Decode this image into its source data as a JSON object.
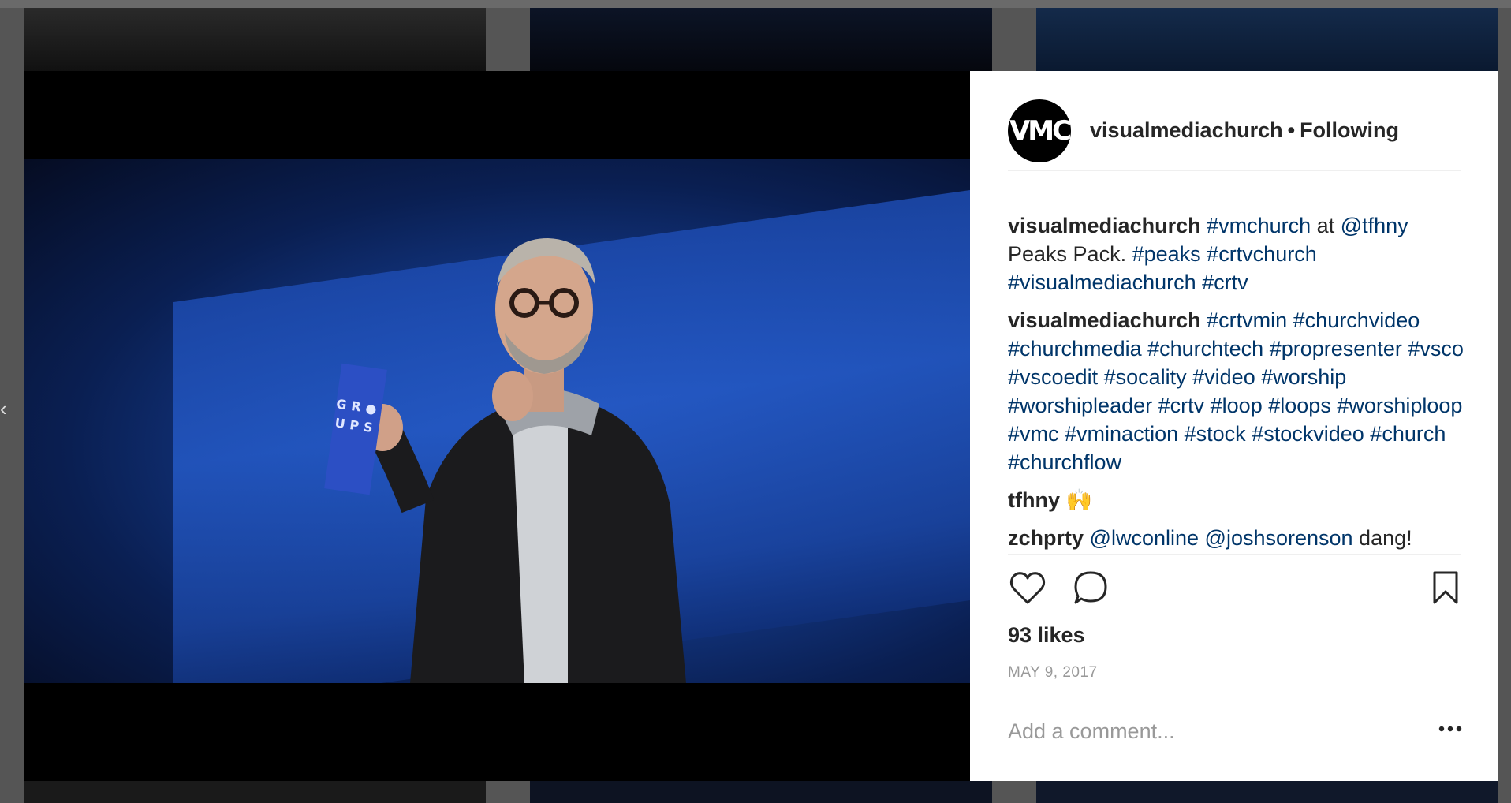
{
  "post": {
    "author": "visualmediachurch",
    "avatar_text": "VMC",
    "follow_separator": "•",
    "follow_status": "Following",
    "image_alt": "Speaker on stage holding a GROUPS card",
    "card_text": "GR●UPS"
  },
  "comments": [
    {
      "user": "visualmediachurch",
      "parts": [
        {
          "t": "tag",
          "v": "#vmchurch"
        },
        {
          "t": "text",
          "v": " at "
        },
        {
          "t": "tag",
          "v": "@tfhny"
        },
        {
          "t": "text",
          "v": " Peaks Pack. "
        },
        {
          "t": "tag",
          "v": "#peaks"
        },
        {
          "t": "text",
          "v": " "
        },
        {
          "t": "tag",
          "v": "#crtvchurch"
        },
        {
          "t": "text",
          "v": " "
        },
        {
          "t": "tag",
          "v": "#visualmediachurch"
        },
        {
          "t": "text",
          "v": " "
        },
        {
          "t": "tag",
          "v": "#crtv"
        }
      ]
    },
    {
      "user": "visualmediachurch",
      "parts": [
        {
          "t": "tag",
          "v": "#crtvmin"
        },
        {
          "t": "text",
          "v": " "
        },
        {
          "t": "tag",
          "v": "#churchvideo"
        },
        {
          "t": "text",
          "v": " "
        },
        {
          "t": "tag",
          "v": "#churchmedia"
        },
        {
          "t": "text",
          "v": " "
        },
        {
          "t": "tag",
          "v": "#churchtech"
        },
        {
          "t": "text",
          "v": " "
        },
        {
          "t": "tag",
          "v": "#propresenter"
        },
        {
          "t": "text",
          "v": " "
        },
        {
          "t": "tag",
          "v": "#vsco"
        },
        {
          "t": "text",
          "v": " "
        },
        {
          "t": "tag",
          "v": "#vscoedit"
        },
        {
          "t": "text",
          "v": " "
        },
        {
          "t": "tag",
          "v": "#socality"
        },
        {
          "t": "text",
          "v": " "
        },
        {
          "t": "tag",
          "v": "#video"
        },
        {
          "t": "text",
          "v": " "
        },
        {
          "t": "tag",
          "v": "#worship"
        },
        {
          "t": "text",
          "v": " "
        },
        {
          "t": "tag",
          "v": "#worshipleader"
        },
        {
          "t": "text",
          "v": " "
        },
        {
          "t": "tag",
          "v": "#crtv"
        },
        {
          "t": "text",
          "v": " "
        },
        {
          "t": "tag",
          "v": "#loop"
        },
        {
          "t": "text",
          "v": " "
        },
        {
          "t": "tag",
          "v": "#loops"
        },
        {
          "t": "text",
          "v": " "
        },
        {
          "t": "tag",
          "v": "#worshiploop"
        },
        {
          "t": "text",
          "v": " "
        },
        {
          "t": "tag",
          "v": "#vmc"
        },
        {
          "t": "text",
          "v": " "
        },
        {
          "t": "tag",
          "v": "#vminaction"
        },
        {
          "t": "text",
          "v": " "
        },
        {
          "t": "tag",
          "v": "#stock"
        },
        {
          "t": "text",
          "v": " "
        },
        {
          "t": "tag",
          "v": "#stockvideo"
        },
        {
          "t": "text",
          "v": " "
        },
        {
          "t": "tag",
          "v": "#church"
        },
        {
          "t": "text",
          "v": " "
        },
        {
          "t": "tag",
          "v": "#churchflow"
        }
      ]
    },
    {
      "user": "tfhny",
      "parts": [
        {
          "t": "text",
          "v": "🙌"
        }
      ]
    },
    {
      "user": "zchprty",
      "parts": [
        {
          "t": "tag",
          "v": "@lwconline"
        },
        {
          "t": "text",
          "v": " "
        },
        {
          "t": "tag",
          "v": "@joshsorenson"
        },
        {
          "t": "text",
          "v": " dang!"
        }
      ]
    }
  ],
  "actions": {
    "like_icon": "heart-outline-icon",
    "comment_icon": "speech-bubble-icon",
    "save_icon": "bookmark-icon"
  },
  "likes_text": "93 likes",
  "date_text": "MAY 9, 2017",
  "comment_input": {
    "placeholder": "Add a comment...",
    "value": ""
  },
  "more_icon": "ellipsis-icon",
  "colors": {
    "link": "#003569",
    "text": "#262626",
    "muted": "#999999",
    "divider": "#efefef"
  }
}
